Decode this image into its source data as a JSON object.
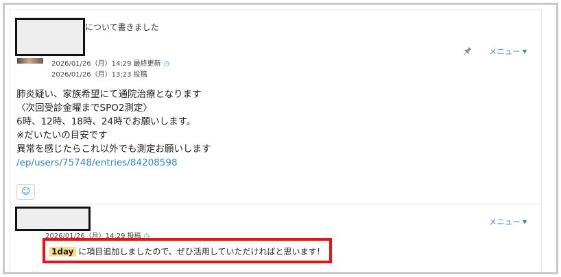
{
  "post": {
    "title": "について書きました",
    "updated_meta": "2026/01/26（月）14:29 最終更新",
    "posted_meta": "2026/01/26（月）13:23 投稿",
    "menu_label": "メニュー",
    "body_lines": [
      "肺炎疑い、家族希望にて通院治療となります",
      "〈次回受診金曜までSPO2測定〉",
      "6時、12時、18時、24時でお願いします。",
      "※だいたいの目安です",
      "異常を感じたらこれ以外でも測定お願いします"
    ],
    "link_text": "/ep/users/75748/entries/84208598"
  },
  "comment": {
    "meta": "2026/01/26（月）14:29 投稿",
    "menu_label": "メニュー",
    "highlight": "1day",
    "text": "に項目追加しましたので、ぜひ活用していただければと思います！"
  },
  "colors": {
    "link": "#2d86c9",
    "accent_red_box": "#ef1111",
    "highlight": "#f7df8a"
  },
  "icons": {
    "clock": "clock-icon",
    "pin": "pin-icon",
    "smile": "smile-icon",
    "caret": "caret-down-icon"
  }
}
